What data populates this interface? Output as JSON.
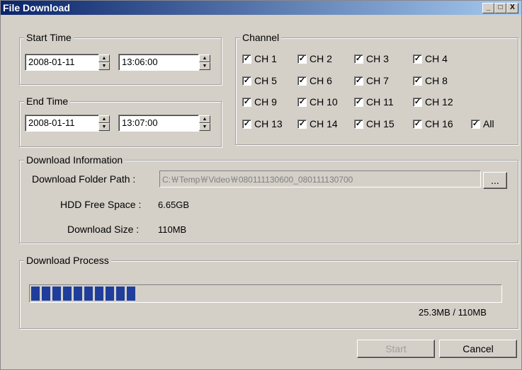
{
  "window": {
    "title": "File Download",
    "buttons": {
      "minimize": "_",
      "maximize": "□",
      "close": "X"
    }
  },
  "start_time": {
    "legend": "Start Time",
    "date": "2008-01-11",
    "time": "13:06:00"
  },
  "end_time": {
    "legend": "End Time",
    "date": "2008-01-11",
    "time": "13:07:00"
  },
  "channel": {
    "legend": "Channel",
    "items": [
      {
        "label": "CH 1",
        "checked": true
      },
      {
        "label": "CH 2",
        "checked": true
      },
      {
        "label": "CH 3",
        "checked": true
      },
      {
        "label": "CH 4",
        "checked": true
      },
      {
        "label": "CH 5",
        "checked": true
      },
      {
        "label": "CH 6",
        "checked": true
      },
      {
        "label": "CH 7",
        "checked": true
      },
      {
        "label": "CH 8",
        "checked": true
      },
      {
        "label": "CH 9",
        "checked": true
      },
      {
        "label": "CH 10",
        "checked": true
      },
      {
        "label": "CH 11",
        "checked": true
      },
      {
        "label": "CH 12",
        "checked": true
      },
      {
        "label": "CH 13",
        "checked": true
      },
      {
        "label": "CH 14",
        "checked": true
      },
      {
        "label": "CH 15",
        "checked": true
      },
      {
        "label": "CH 16",
        "checked": true
      }
    ],
    "all": {
      "label": "All",
      "checked": true
    }
  },
  "download_info": {
    "legend": "Download Information",
    "folder_label": "Download Folder Path :",
    "folder_value": "C:￦Temp￦Video￦080111130600_080111130700",
    "browse_label": "...",
    "hdd_label": "HDD Free Space :",
    "hdd_value": "6.65GB",
    "size_label": "Download Size :",
    "size_value": "110MB"
  },
  "download_process": {
    "legend": "Download Process",
    "progress": 0.23,
    "status": "25.3MB / 110MB"
  },
  "buttons": {
    "start": "Start",
    "cancel": "Cancel"
  }
}
